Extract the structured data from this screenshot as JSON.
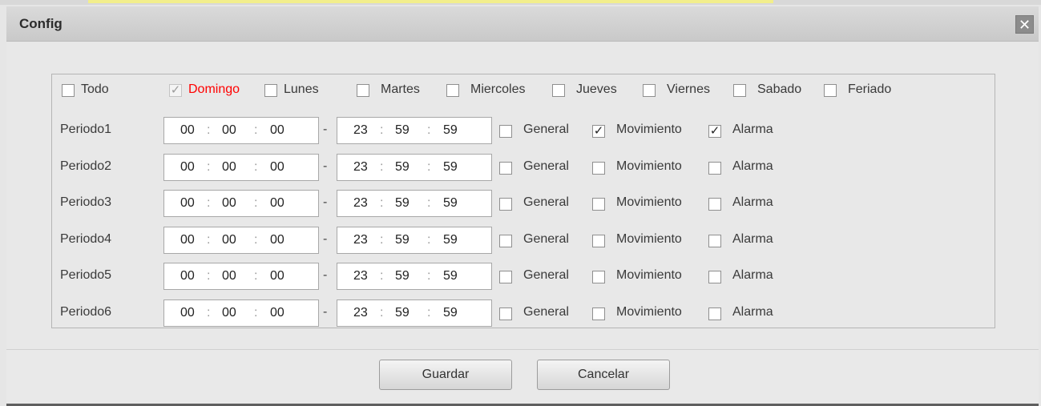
{
  "dialog": {
    "title": "Config",
    "close_glyph": "✕"
  },
  "days": [
    {
      "label": "Todo",
      "checked": false,
      "disabled": false,
      "highlight": false
    },
    {
      "label": "Domingo",
      "checked": true,
      "disabled": true,
      "highlight": true
    },
    {
      "label": "Lunes",
      "checked": false,
      "disabled": false,
      "highlight": false
    },
    {
      "label": "Martes",
      "checked": false,
      "disabled": false,
      "highlight": false
    },
    {
      "label": "Miercoles",
      "checked": false,
      "disabled": false,
      "highlight": false
    },
    {
      "label": "Jueves",
      "checked": false,
      "disabled": false,
      "highlight": false
    },
    {
      "label": "Viernes",
      "checked": false,
      "disabled": false,
      "highlight": false
    },
    {
      "label": "Sabado",
      "checked": false,
      "disabled": false,
      "highlight": false
    },
    {
      "label": "Feriado",
      "checked": false,
      "disabled": false,
      "highlight": false
    }
  ],
  "time_separator": ":",
  "range_separator": "-",
  "periods": [
    {
      "label": "Periodo1",
      "start": [
        "00",
        "00",
        "00"
      ],
      "end": [
        "23",
        "59",
        "59"
      ],
      "types": [
        {
          "label": "General",
          "checked": false
        },
        {
          "label": "Movimiento",
          "checked": true
        },
        {
          "label": "Alarma",
          "checked": true
        }
      ]
    },
    {
      "label": "Periodo2",
      "start": [
        "00",
        "00",
        "00"
      ],
      "end": [
        "23",
        "59",
        "59"
      ],
      "types": [
        {
          "label": "General",
          "checked": false
        },
        {
          "label": "Movimiento",
          "checked": false
        },
        {
          "label": "Alarma",
          "checked": false
        }
      ]
    },
    {
      "label": "Periodo3",
      "start": [
        "00",
        "00",
        "00"
      ],
      "end": [
        "23",
        "59",
        "59"
      ],
      "types": [
        {
          "label": "General",
          "checked": false
        },
        {
          "label": "Movimiento",
          "checked": false
        },
        {
          "label": "Alarma",
          "checked": false
        }
      ]
    },
    {
      "label": "Periodo4",
      "start": [
        "00",
        "00",
        "00"
      ],
      "end": [
        "23",
        "59",
        "59"
      ],
      "types": [
        {
          "label": "General",
          "checked": false
        },
        {
          "label": "Movimiento",
          "checked": false
        },
        {
          "label": "Alarma",
          "checked": false
        }
      ]
    },
    {
      "label": "Periodo5",
      "start": [
        "00",
        "00",
        "00"
      ],
      "end": [
        "23",
        "59",
        "59"
      ],
      "types": [
        {
          "label": "General",
          "checked": false
        },
        {
          "label": "Movimiento",
          "checked": false
        },
        {
          "label": "Alarma",
          "checked": false
        }
      ]
    },
    {
      "label": "Periodo6",
      "start": [
        "00",
        "00",
        "00"
      ],
      "end": [
        "23",
        "59",
        "59"
      ],
      "types": [
        {
          "label": "General",
          "checked": false
        },
        {
          "label": "Movimiento",
          "checked": false
        },
        {
          "label": "Alarma",
          "checked": false
        }
      ]
    }
  ],
  "buttons": {
    "save": "Guardar",
    "cancel": "Cancelar"
  },
  "check_glyph": "✓",
  "colors": {
    "highlight": "#ff0000"
  }
}
